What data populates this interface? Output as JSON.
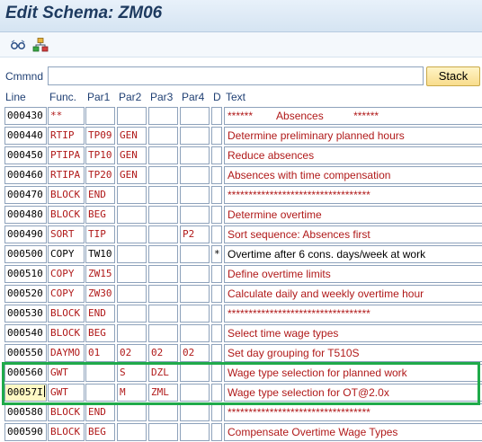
{
  "window": {
    "title": "Edit Schema: ZM06"
  },
  "toolbar": {
    "icons": [
      {
        "name": "glasses-display-icon"
      },
      {
        "name": "hierarchy-structure-icon"
      }
    ]
  },
  "command": {
    "label": "Cmmnd",
    "value": "",
    "button_label": "Stack"
  },
  "columns": {
    "line": "Line",
    "func": "Func.",
    "par1": "Par1",
    "par2": "Par2",
    "par3": "Par3",
    "par4": "Par4",
    "d": "D",
    "text": "Text"
  },
  "rows": [
    {
      "line": "000430",
      "func": "**",
      "par1": "",
      "par2": "",
      "par3": "",
      "par4": "",
      "d": "",
      "text": "******        Absences          ******"
    },
    {
      "line": "000440",
      "func": "RTIP",
      "par1": "TP09",
      "par2": "GEN",
      "par3": "",
      "par4": "",
      "d": "",
      "text": "Determine preliminary planned hours"
    },
    {
      "line": "000450",
      "func": "PTIPA",
      "par1": "TP10",
      "par2": "GEN",
      "par3": "",
      "par4": "",
      "d": "",
      "text": "Reduce absences"
    },
    {
      "line": "000460",
      "func": "RTIPA",
      "par1": "TP20",
      "par2": "GEN",
      "par3": "",
      "par4": "",
      "d": "",
      "text": "Absences with time compensation"
    },
    {
      "line": "000470",
      "func": "BLOCK",
      "par1": "END",
      "par2": "",
      "par3": "",
      "par4": "",
      "d": "",
      "text": "**********************************"
    },
    {
      "line": "000480",
      "func": "BLOCK",
      "par1": "BEG",
      "par2": "",
      "par3": "",
      "par4": "",
      "d": "",
      "text": "Determine overtime"
    },
    {
      "line": "000490",
      "func": "SORT",
      "par1": "TIP",
      "par2": "",
      "par3": "",
      "par4": "P2",
      "d": "",
      "text": "Sort sequence: Absences first"
    },
    {
      "line": "000500",
      "func": "COPY",
      "par1": "TW10",
      "par2": "",
      "par3": "",
      "par4": "",
      "d": "*",
      "text": "Overtime after 6 cons. days/week at work"
    },
    {
      "line": "000510",
      "func": "COPY",
      "par1": "ZW15",
      "par2": "",
      "par3": "",
      "par4": "",
      "d": "",
      "text": "Define overtime limits"
    },
    {
      "line": "000520",
      "func": "COPY",
      "par1": "ZW30",
      "par2": "",
      "par3": "",
      "par4": "",
      "d": "",
      "text": "Calculate daily and weekly overtime hour"
    },
    {
      "line": "000530",
      "func": "BLOCK",
      "par1": "END",
      "par2": "",
      "par3": "",
      "par4": "",
      "d": "",
      "text": "**********************************"
    },
    {
      "line": "000540",
      "func": "BLOCK",
      "par1": "BEG",
      "par2": "",
      "par3": "",
      "par4": "",
      "d": "",
      "text": "Select time wage types"
    },
    {
      "line": "000550",
      "func": "DAYMO",
      "par1": "01",
      "par2": "02",
      "par3": "02",
      "par4": "02",
      "d": "",
      "text": "Set day grouping for T510S"
    },
    {
      "line": "000560",
      "func": "GWT",
      "par1": "",
      "par2": "S",
      "par3": "DZL",
      "par4": "",
      "d": "",
      "text": "Wage type selection for planned work"
    },
    {
      "line": "00057I",
      "func": "GWT",
      "par1": "",
      "par2": "M",
      "par3": "ZML",
      "par4": "",
      "d": "",
      "text": "Wage type selection for OT@2.0x"
    },
    {
      "line": "000580",
      "func": "BLOCK",
      "par1": "END",
      "par2": "",
      "par3": "",
      "par4": "",
      "d": "",
      "text": "**********************************"
    },
    {
      "line": "000590",
      "func": "BLOCK",
      "par1": "BEG",
      "par2": "",
      "par3": "",
      "par4": "",
      "d": "",
      "text": "Compensate Overtime Wage Types"
    }
  ],
  "colors": {
    "text_red": "#b01919",
    "highlight_green": "#1faa4a",
    "header_blue": "#1f3f73"
  }
}
